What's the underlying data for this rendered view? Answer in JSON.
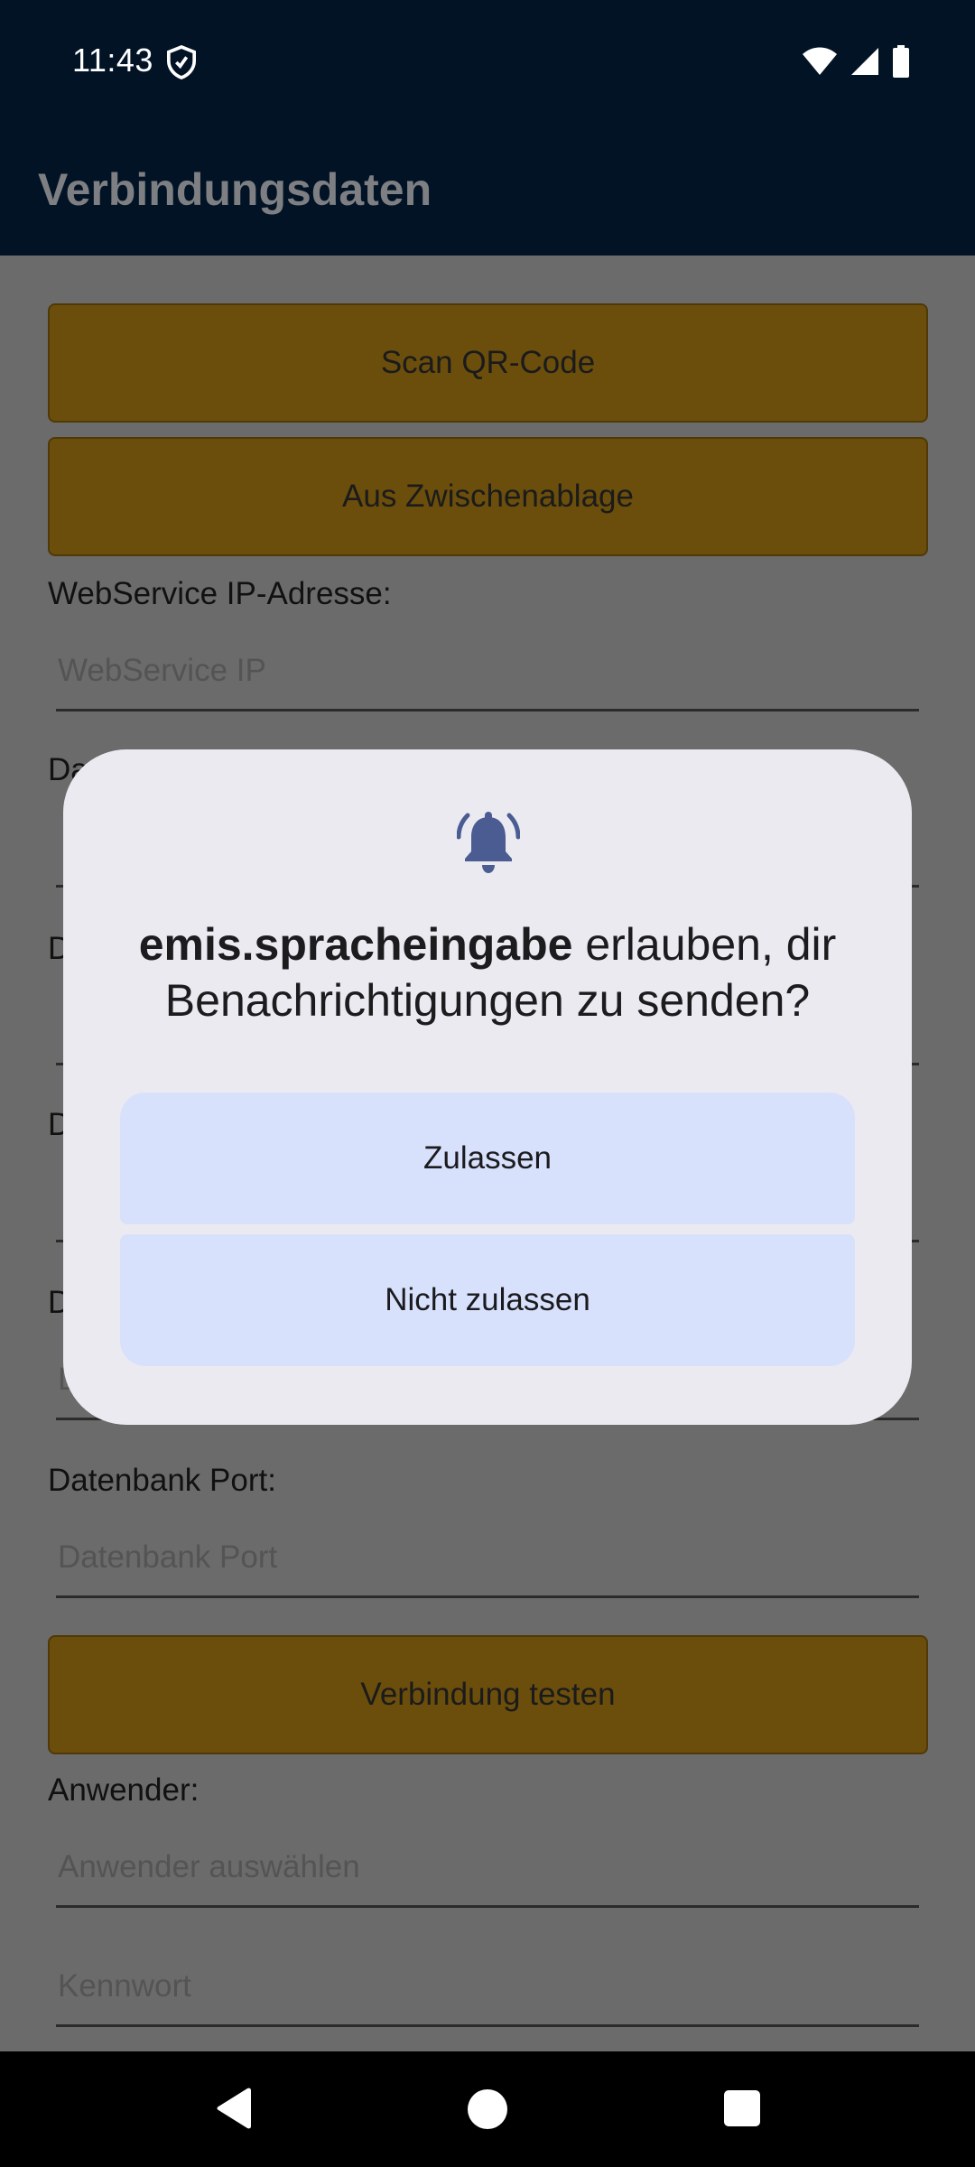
{
  "status_bar": {
    "time": "11:43",
    "icons": [
      "vpn-shield-icon",
      "wifi-icon",
      "signal-icon",
      "battery-icon"
    ]
  },
  "app_bar": {
    "title": "Verbindungsdaten"
  },
  "form": {
    "scan_button": "Scan QR-Code",
    "clipboard_button": "Aus Zwischenablage",
    "webservice_ip_label": "WebService IP-Adresse:",
    "webservice_ip_placeholder": "WebService IP",
    "partial_labels": [
      "Da",
      "D",
      "D",
      "D"
    ],
    "partial_placeholder": "D",
    "db_port_label": "Datenbank Port:",
    "db_port_placeholder": "Datenbank Port",
    "test_button": "Verbindung testen",
    "user_label": "Anwender:",
    "user_placeholder": "Anwender auswählen",
    "password_placeholder": "Kennwort"
  },
  "dialog": {
    "icon": "notification-bell-icon",
    "app_name": "emis.spracheingabe",
    "message": " erlauben, dir Benachrichtigungen zu senden?",
    "allow_button": "Zulassen",
    "deny_button": "Nicht zulassen"
  },
  "colors": {
    "status_bar_bg": "#021326",
    "scrim_bg": "#6b6b6b",
    "button_bg": "#6b4e0c",
    "dialog_bg": "#ebeaf0",
    "dialog_button_bg": "#d8e1fb",
    "bell_color": "#4a5c92"
  }
}
